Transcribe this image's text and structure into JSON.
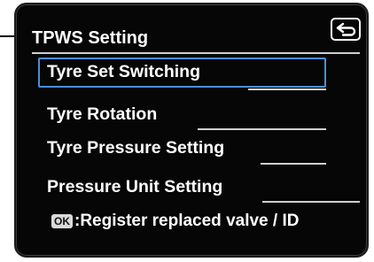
{
  "screen": {
    "title": "TPWS Setting",
    "back_icon": "return-arrow-icon"
  },
  "menu": {
    "items": [
      {
        "label": "Tyre Set Switching",
        "selected": true
      },
      {
        "label": "Tyre Rotation",
        "selected": false
      },
      {
        "label": "Tyre Pressure Setting",
        "selected": false
      },
      {
        "label": "Pressure Unit Setting",
        "selected": false
      }
    ]
  },
  "footer": {
    "ok_badge": "OK",
    "hint": ":Register replaced valve / ID"
  },
  "colors": {
    "background": "#060606",
    "text": "#ffffff",
    "selection_border": "#4a8fd6",
    "divider": "#cfcfcf"
  }
}
